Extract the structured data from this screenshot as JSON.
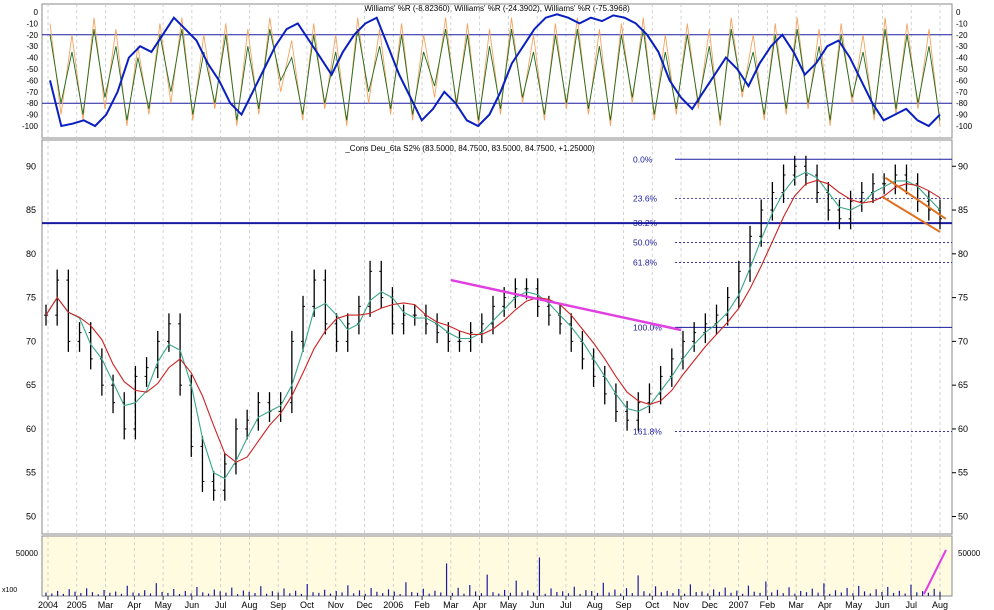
{
  "chart_data": [
    {
      "type": "line",
      "panel": "williams_r",
      "title": "Williams' %R (-8.82360), Williams' %R (-24.3902), Williams' %R (-75.3968)",
      "ylim": [
        -100,
        0
      ],
      "yticks": [
        0,
        -10,
        -20,
        -30,
        -40,
        -50,
        -60,
        -70,
        -80,
        -90,
        -100
      ],
      "reference_lines": [
        -20,
        -80
      ],
      "grid": "vertical dashed at months",
      "series": [
        {
          "color": "#f4a460",
          "values": [
            -10,
            -90,
            -20,
            -95,
            -5,
            -85,
            -15,
            -100,
            -30,
            -90,
            -10,
            -80,
            -5,
            -95,
            -20,
            -85,
            -10,
            -100,
            -15,
            -90,
            -5,
            -70,
            -25,
            -95,
            -10,
            -85,
            -20,
            -100,
            -5,
            -80,
            -15,
            -90,
            -10,
            -95,
            -20,
            -75,
            -5,
            -85,
            -10,
            -100,
            -15,
            -90,
            -5,
            -80,
            -20,
            -95,
            -10,
            -85,
            -5,
            -90,
            -15,
            -100,
            -10,
            -80,
            -5,
            -95,
            -20,
            -90,
            -10,
            -85,
            -15,
            -100,
            -5,
            -75,
            -20,
            -95,
            -10,
            -90,
            -5,
            -85,
            -15,
            -100,
            -10,
            -80,
            -20,
            -95,
            -5,
            -90,
            -10,
            -85,
            -15,
            -100
          ]
        },
        {
          "color": "#1e6b1e",
          "values": [
            -20,
            -80,
            -35,
            -90,
            -15,
            -75,
            -30,
            -95,
            -40,
            -85,
            -20,
            -70,
            -15,
            -90,
            -35,
            -80,
            -20,
            -95,
            -30,
            -85,
            -15,
            -60,
            -40,
            -90,
            -20,
            -80,
            -35,
            -95,
            -15,
            -70,
            -30,
            -85,
            -20,
            -90,
            -35,
            -65,
            -15,
            -80,
            -20,
            -95,
            -30,
            -85,
            -15,
            -75,
            -35,
            -90,
            -20,
            -80,
            -15,
            -85,
            -30,
            -95,
            -20,
            -75,
            -15,
            -90,
            -35,
            -85,
            -20,
            -80,
            -30,
            -95,
            -15,
            -70,
            -35,
            -90,
            -20,
            -85,
            -15,
            -80,
            -30,
            -95,
            -20,
            -75,
            -35,
            -90,
            -15,
            -85,
            -20,
            -80,
            -30,
            -95
          ]
        },
        {
          "color": "#0a1fbf",
          "values": [
            -60,
            -100,
            -98,
            -95,
            -100,
            -90,
            -70,
            -40,
            -30,
            -35,
            -20,
            -5,
            -15,
            -25,
            -45,
            -60,
            -80,
            -90,
            -70,
            -50,
            -30,
            -15,
            -10,
            -25,
            -40,
            -55,
            -35,
            -20,
            -10,
            -5,
            -30,
            -55,
            -75,
            -95,
            -85,
            -70,
            -80,
            -95,
            -100,
            -90,
            -70,
            -45,
            -30,
            -15,
            -5,
            -2,
            -5,
            -10,
            -5,
            -8,
            -3,
            -5,
            -10,
            -20,
            -35,
            -60,
            -75,
            -85,
            -70,
            -55,
            -40,
            -50,
            -65,
            -45,
            -30,
            -20,
            -35,
            -55,
            -45,
            -30,
            -25,
            -40,
            -60,
            -80,
            -95,
            -90,
            -85,
            -95,
            -100,
            -90
          ]
        }
      ]
    },
    {
      "type": "candlestick",
      "panel": "price",
      "title": "_Cons Deu_6ta S2% (83.5000, 84.7500, 83.5000, 84.7500, +1.25000)",
      "ylim": [
        48,
        93
      ],
      "yticks": [
        50,
        55,
        60,
        65,
        70,
        75,
        80,
        85,
        90
      ],
      "x_labels": [
        "2004",
        "2005",
        "Mar",
        "Apr",
        "May",
        "Jun",
        "Jul",
        "Aug",
        "Sep",
        "Oct",
        "Nov",
        "Dec",
        "2006",
        "Feb",
        "Mar",
        "Apr",
        "May",
        "Jun",
        "Jul",
        "Aug",
        "Sep",
        "Oct",
        "Nov",
        "Dec",
        "2007",
        "Feb",
        "Mar",
        "Apr",
        "May",
        "Jun",
        "Jul",
        "Aug"
      ],
      "close": [
        73,
        77,
        70,
        71,
        68,
        65,
        63,
        60,
        66,
        67,
        70,
        72,
        65,
        58,
        54,
        53,
        56,
        60,
        61,
        63,
        62,
        63,
        70,
        74,
        77,
        72,
        70,
        72,
        74,
        78,
        75,
        72,
        73,
        73,
        72,
        71,
        70,
        70,
        71,
        72,
        74,
        75,
        76,
        76,
        74,
        73,
        72,
        70,
        68,
        66,
        64,
        62,
        61,
        63,
        64,
        66,
        68,
        70,
        71,
        72,
        73,
        75,
        78,
        82,
        85,
        87,
        89,
        90,
        89,
        87,
        85,
        84,
        86,
        87,
        88,
        88,
        89,
        88,
        86,
        85,
        84
      ],
      "fibonacci": [
        {
          "label": "0.0%",
          "value": 90.8
        },
        {
          "label": "23.6%",
          "value": 86.3
        },
        {
          "label": "38.2%",
          "value": 83.5
        },
        {
          "label": "50.0%",
          "value": 81.3
        },
        {
          "label": "61.8%",
          "value": 79.0
        },
        {
          "label": "100.0%",
          "value": 71.6
        },
        {
          "label": "161.8%",
          "value": 59.7
        }
      ],
      "support_line": 83.5,
      "trendline_magenta": [
        [
          14,
          77
        ],
        [
          22,
          71.3
        ]
      ],
      "channel_orange": [
        [
          29.1,
          88.7
        ],
        [
          31.2,
          84.0
        ],
        [
          29.0,
          86.5
        ],
        [
          31.0,
          82.5
        ]
      ]
    },
    {
      "type": "bar",
      "panel": "volume",
      "unit_label": "x100",
      "ylim": [
        0,
        70000
      ],
      "yticks": [
        50000
      ],
      "values": [
        4000,
        3000,
        6000,
        2500,
        8000,
        5000,
        3500,
        9000,
        4500,
        2000,
        7000,
        3800,
        5200,
        2600,
        12000,
        4100,
        3300,
        6800,
        2900,
        15000,
        4700,
        3600,
        8200,
        2400,
        5900,
        3100,
        10500,
        4300,
        2800,
        7600,
        5400,
        3900,
        9800,
        2200,
        6400,
        4800,
        3500,
        11500,
        2700,
        5600,
        4000,
        8800,
        3200,
        6100,
        2500,
        14000,
        4400,
        3700,
        7300,
        2900,
        5800,
        4200,
        12500,
        3100,
        6600,
        2600,
        9300,
        4900,
        3400,
        7800,
        5100,
        2300,
        16000,
        4600,
        3800,
        8500,
        2800,
        6200,
        4100,
        38000,
        3600,
        9600,
        2700,
        12800,
        5300,
        3300,
        25000,
        4500,
        2900,
        7100,
        3700,
        18000,
        4300,
        6400,
        3900,
        45000,
        2600,
        8900,
        4700,
        5500,
        3200,
        10800,
        2400,
        6900,
        5800,
        3600,
        15500,
        4100,
        7500,
        2800,
        9100,
        3400,
        24000,
        5600,
        2900,
        11300,
        4400,
        6000,
        3500,
        8300,
        2700,
        13600,
        4600,
        5200,
        3100,
        7700,
        4800,
        9900,
        3800,
        6300,
        2600,
        12100,
        5000,
        3700,
        17000,
        4200,
        7200,
        3300,
        10200,
        2800,
        5900,
        4500,
        8600,
        3900,
        14800,
        2500,
        6700,
        4100,
        9400,
        3200,
        11800,
        5400,
        3000,
        7900,
        4700,
        10600,
        3600,
        6100,
        2900,
        13200,
        4300,
        5700,
        3800,
        8400,
        4900
      ]
    }
  ]
}
